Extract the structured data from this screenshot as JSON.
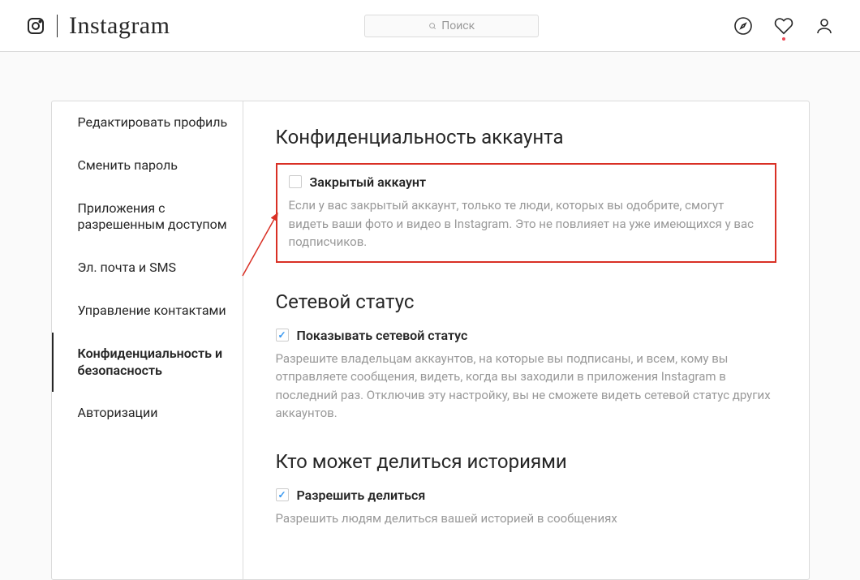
{
  "header": {
    "brand": "Instagram",
    "search_placeholder": "Поиск"
  },
  "sidebar": {
    "items": [
      {
        "label": "Редактировать профиль"
      },
      {
        "label": "Сменить пароль"
      },
      {
        "label": "Приложения с разрешенным доступом"
      },
      {
        "label": "Эл. почта и SMS"
      },
      {
        "label": "Управление контактами"
      },
      {
        "label": "Конфиденциальность и безопасность"
      },
      {
        "label": "Авторизации"
      }
    ]
  },
  "content": {
    "section1": {
      "title": "Конфиденциальность аккаунта",
      "option_label": "Закрытый аккаунт",
      "option_desc": "Если у вас закрытый аккаунт, только те люди, которых вы одобрите, смогут видеть ваши фото и видео в Instagram. Это не повлияет на уже имеющихся у вас подписчиков."
    },
    "section2": {
      "title": "Сетевой статус",
      "option_label": "Показывать сетевой статус",
      "option_desc": "Разрешите владельцам аккаунтов, на которые вы подписаны, и всем, кому вы отправляете сообщения, видеть, когда вы заходили в приложения Instagram в последний раз. Отключив эту настройку, вы не сможете видеть сетевой статус других аккаунтов."
    },
    "section3": {
      "title": "Кто может делиться историями",
      "option_label": "Разрешить делиться",
      "option_desc": "Разрешить людям делиться вашей историей в сообщениях"
    }
  }
}
